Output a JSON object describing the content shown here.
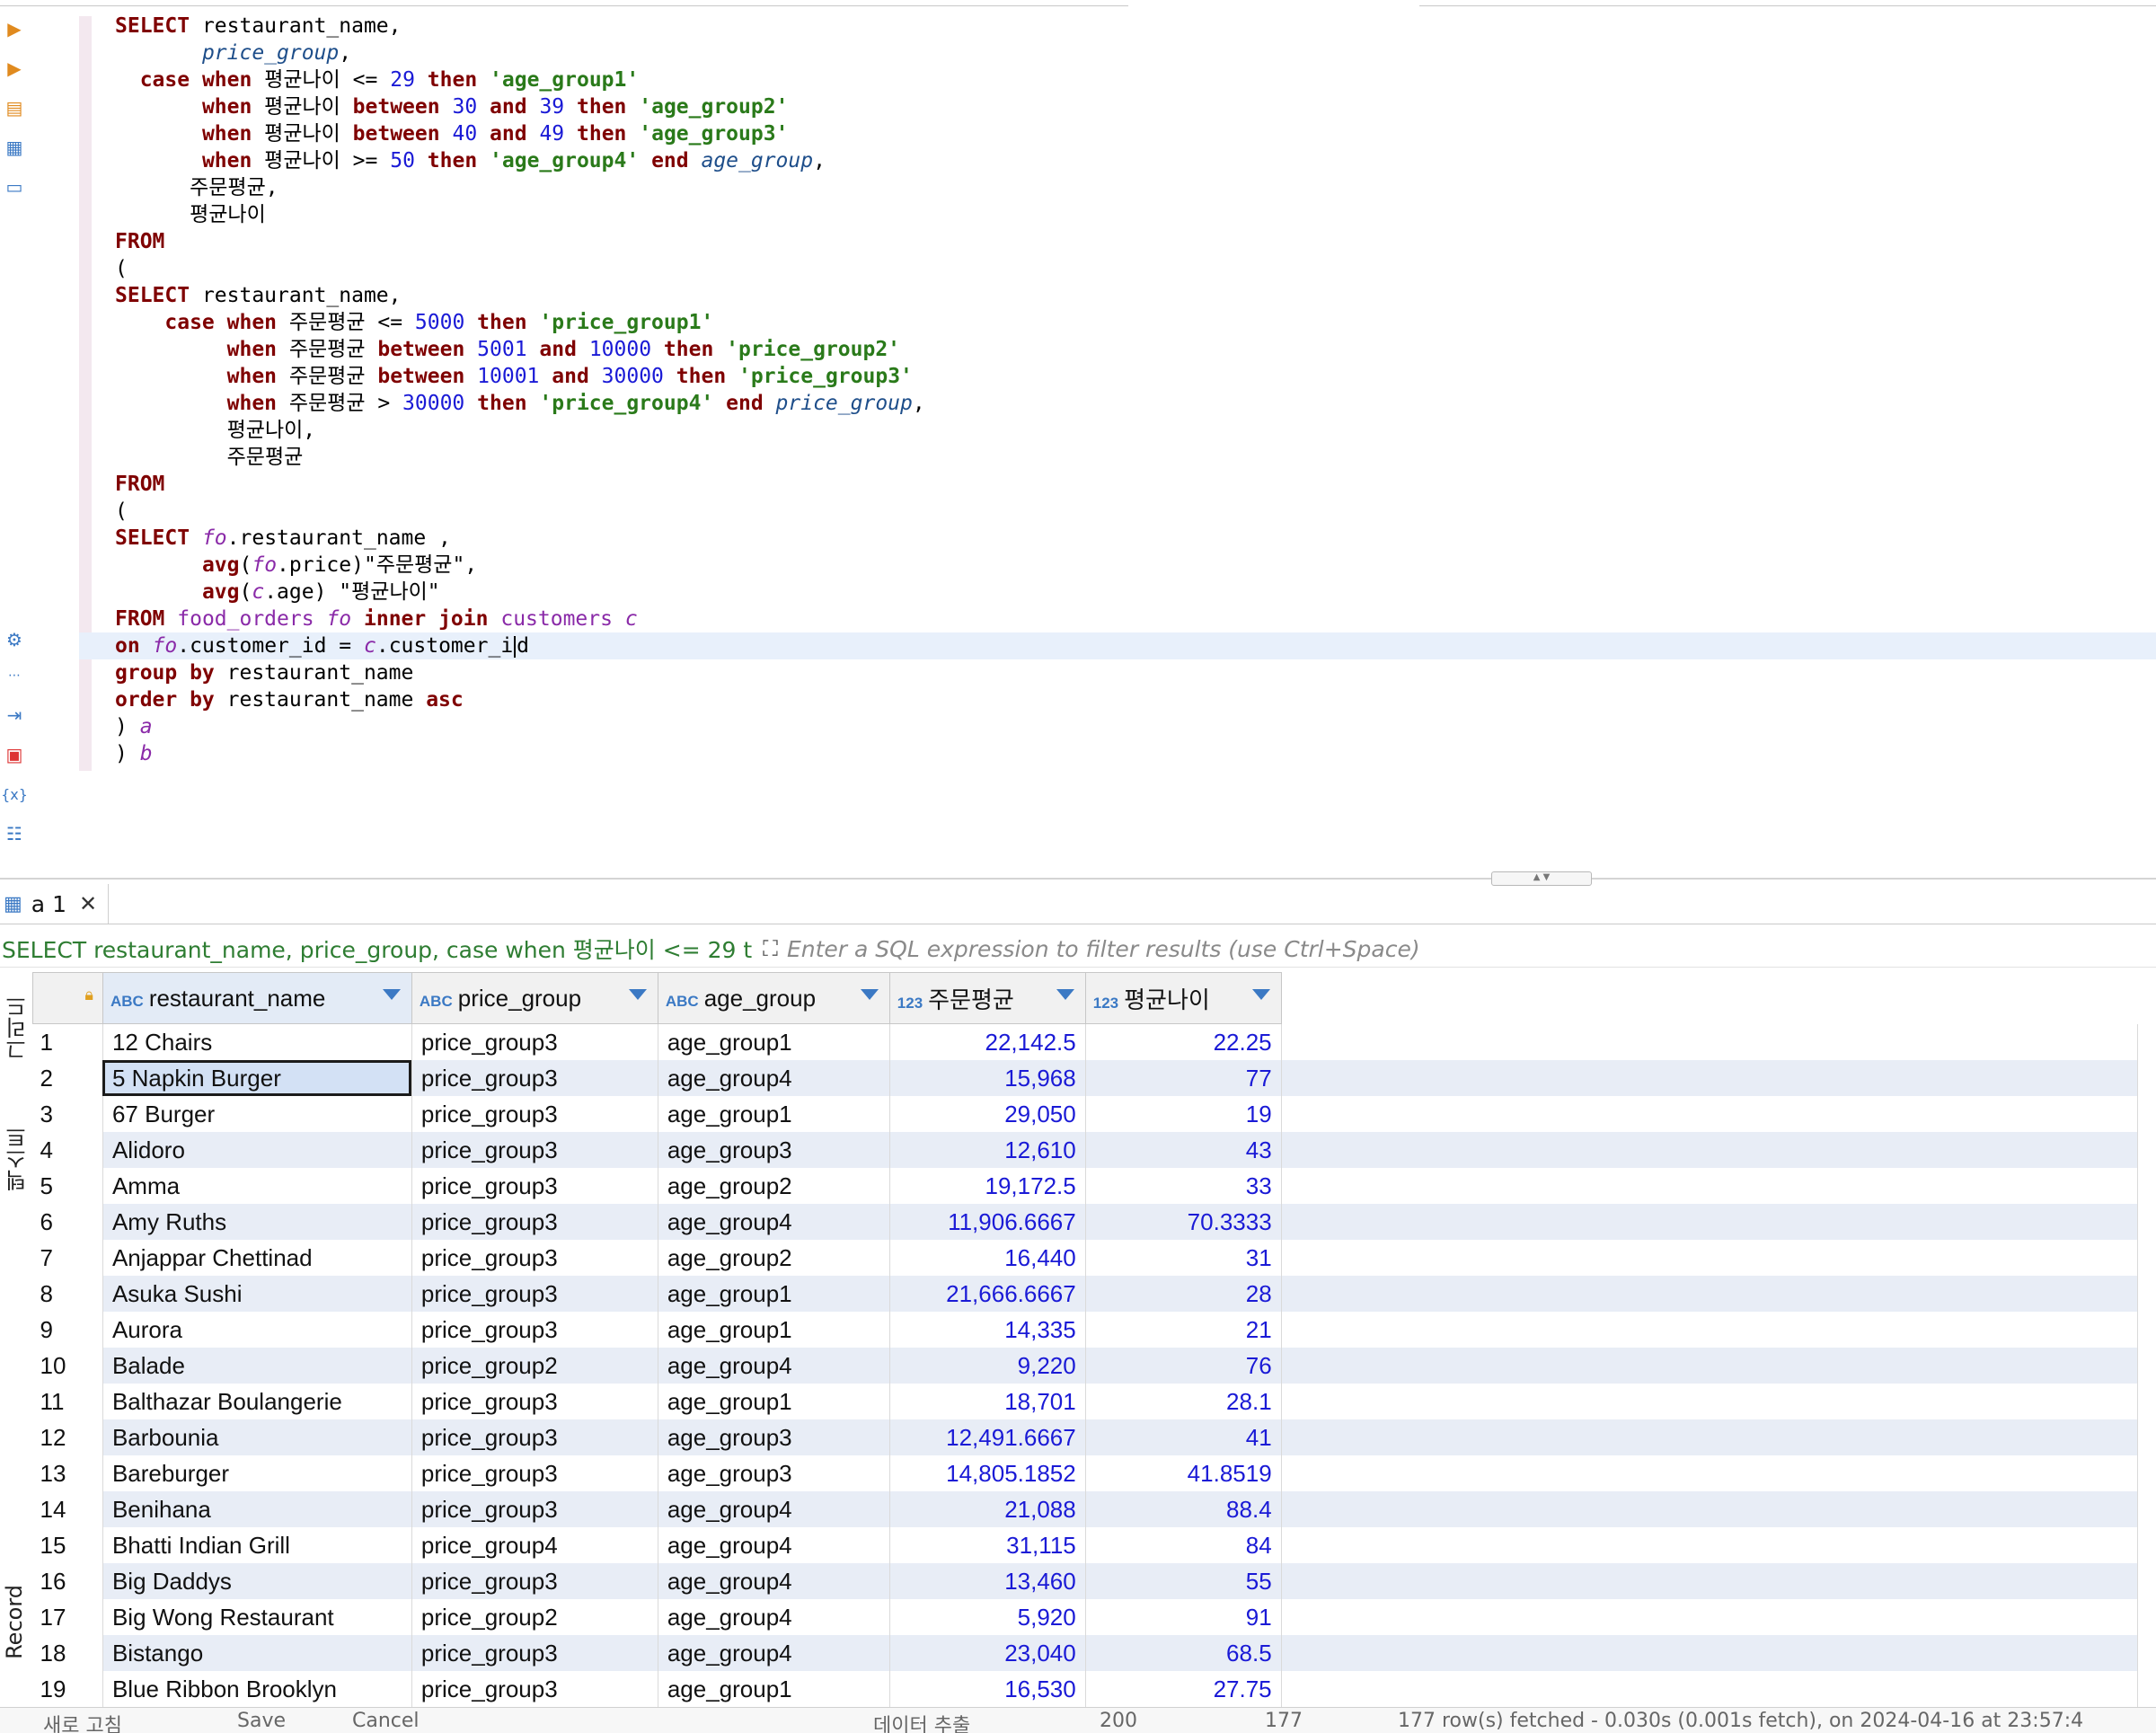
{
  "editor": {
    "lines": [
      [
        [
          "kw",
          "SELECT"
        ],
        [
          "t",
          " restaurant_name,"
        ]
      ],
      [
        [
          "t",
          "       "
        ],
        [
          "itc",
          "price_group"
        ],
        [
          "t",
          ","
        ]
      ],
      [
        [
          "t",
          "  "
        ],
        [
          "kw",
          "case"
        ],
        [
          "t",
          " "
        ],
        [
          "kw",
          "when"
        ],
        [
          "t",
          " 평균나이 <= "
        ],
        [
          "num",
          "29"
        ],
        [
          "t",
          " "
        ],
        [
          "kw",
          "then"
        ],
        [
          "t",
          " "
        ],
        [
          "str",
          "'age_group1'"
        ]
      ],
      [
        [
          "t",
          "       "
        ],
        [
          "kw",
          "when"
        ],
        [
          "t",
          " 평균나이 "
        ],
        [
          "kw",
          "between"
        ],
        [
          "t",
          " "
        ],
        [
          "num",
          "30"
        ],
        [
          "t",
          " "
        ],
        [
          "kw",
          "and"
        ],
        [
          "t",
          " "
        ],
        [
          "num",
          "39"
        ],
        [
          "t",
          " "
        ],
        [
          "kw",
          "then"
        ],
        [
          "t",
          " "
        ],
        [
          "str",
          "'age_group2'"
        ]
      ],
      [
        [
          "t",
          "       "
        ],
        [
          "kw",
          "when"
        ],
        [
          "t",
          " 평균나이 "
        ],
        [
          "kw",
          "between"
        ],
        [
          "t",
          " "
        ],
        [
          "num",
          "40"
        ],
        [
          "t",
          " "
        ],
        [
          "kw",
          "and"
        ],
        [
          "t",
          " "
        ],
        [
          "num",
          "49"
        ],
        [
          "t",
          " "
        ],
        [
          "kw",
          "then"
        ],
        [
          "t",
          " "
        ],
        [
          "str",
          "'age_group3'"
        ]
      ],
      [
        [
          "t",
          "       "
        ],
        [
          "kw",
          "when"
        ],
        [
          "t",
          " 평균나이 >= "
        ],
        [
          "num",
          "50"
        ],
        [
          "t",
          " "
        ],
        [
          "kw",
          "then"
        ],
        [
          "t",
          " "
        ],
        [
          "str",
          "'age_group4'"
        ],
        [
          "t",
          " "
        ],
        [
          "kw",
          "end"
        ],
        [
          "t",
          " "
        ],
        [
          "itc",
          "age_group"
        ],
        [
          "t",
          ","
        ]
      ],
      [
        [
          "t",
          "      주문평균,"
        ]
      ],
      [
        [
          "t",
          "      평균나이"
        ]
      ],
      [
        [
          "kw",
          "FROM"
        ]
      ],
      [
        [
          "t",
          "("
        ]
      ],
      [
        [
          "kw",
          "SELECT"
        ],
        [
          "t",
          " restaurant_name,"
        ]
      ],
      [
        [
          "t",
          "    "
        ],
        [
          "kw",
          "case"
        ],
        [
          "t",
          " "
        ],
        [
          "kw",
          "when"
        ],
        [
          "t",
          " 주문평균 <= "
        ],
        [
          "num",
          "5000"
        ],
        [
          "t",
          " "
        ],
        [
          "kw",
          "then"
        ],
        [
          "t",
          " "
        ],
        [
          "str",
          "'price_group1'"
        ]
      ],
      [
        [
          "t",
          "         "
        ],
        [
          "kw",
          "when"
        ],
        [
          "t",
          " 주문평균 "
        ],
        [
          "kw",
          "between"
        ],
        [
          "t",
          " "
        ],
        [
          "num",
          "5001"
        ],
        [
          "t",
          " "
        ],
        [
          "kw",
          "and"
        ],
        [
          "t",
          " "
        ],
        [
          "num",
          "10000"
        ],
        [
          "t",
          " "
        ],
        [
          "kw",
          "then"
        ],
        [
          "t",
          " "
        ],
        [
          "str",
          "'price_group2'"
        ]
      ],
      [
        [
          "t",
          "         "
        ],
        [
          "kw",
          "when"
        ],
        [
          "t",
          " 주문평균 "
        ],
        [
          "kw",
          "between"
        ],
        [
          "t",
          " "
        ],
        [
          "num",
          "10001"
        ],
        [
          "t",
          " "
        ],
        [
          "kw",
          "and"
        ],
        [
          "t",
          " "
        ],
        [
          "num",
          "30000"
        ],
        [
          "t",
          " "
        ],
        [
          "kw",
          "then"
        ],
        [
          "t",
          " "
        ],
        [
          "str",
          "'price_group3'"
        ]
      ],
      [
        [
          "t",
          "         "
        ],
        [
          "kw",
          "when"
        ],
        [
          "t",
          " 주문평균 > "
        ],
        [
          "num",
          "30000"
        ],
        [
          "t",
          " "
        ],
        [
          "kw",
          "then"
        ],
        [
          "t",
          " "
        ],
        [
          "str",
          "'price_group4'"
        ],
        [
          "t",
          " "
        ],
        [
          "kw",
          "end"
        ],
        [
          "t",
          " "
        ],
        [
          "itc",
          "price_group"
        ],
        [
          "t",
          ","
        ]
      ],
      [
        [
          "t",
          "         평균나이,"
        ]
      ],
      [
        [
          "t",
          "         주문평균"
        ]
      ],
      [
        [
          "kw",
          "FROM"
        ]
      ],
      [
        [
          "t",
          "("
        ]
      ],
      [
        [
          "kw",
          "SELECT"
        ],
        [
          "t",
          " "
        ],
        [
          "ali",
          "fo"
        ],
        [
          "t",
          ".restaurant_name ,"
        ]
      ],
      [
        [
          "t",
          "       "
        ],
        [
          "kw",
          "avg"
        ],
        [
          "t",
          "("
        ],
        [
          "ali",
          "fo"
        ],
        [
          "t",
          ".price)\"주문평균\","
        ]
      ],
      [
        [
          "t",
          "       "
        ],
        [
          "kw",
          "avg"
        ],
        [
          "t",
          "("
        ],
        [
          "ali",
          "c"
        ],
        [
          "t",
          ".age) \"평균나이\""
        ]
      ],
      [
        [
          "kw",
          "FROM"
        ],
        [
          "t",
          " "
        ],
        [
          "tbl",
          "food_orders"
        ],
        [
          "t",
          " "
        ],
        [
          "ali",
          "fo"
        ],
        [
          "t",
          " "
        ],
        [
          "kw",
          "inner join"
        ],
        [
          "t",
          " "
        ],
        [
          "tbl",
          "customers"
        ],
        [
          "t",
          " "
        ],
        [
          "ali",
          "c"
        ]
      ],
      [
        [
          "kw",
          "on"
        ],
        [
          "t",
          " "
        ],
        [
          "ali",
          "fo"
        ],
        [
          "t",
          ".customer_id = "
        ],
        [
          "ali",
          "c"
        ],
        [
          "t",
          ".customer_i"
        ],
        [
          "caret",
          ""
        ],
        [
          "t",
          "d"
        ]
      ],
      [
        [
          "kw",
          "group by"
        ],
        [
          "t",
          " restaurant_name"
        ]
      ],
      [
        [
          "kw",
          "order by"
        ],
        [
          "t",
          " restaurant_name "
        ],
        [
          "kw",
          "asc"
        ]
      ],
      [
        [
          "t",
          ") "
        ],
        [
          "ali",
          "a"
        ]
      ],
      [
        [
          "t",
          ") "
        ],
        [
          "ali",
          "b"
        ]
      ]
    ],
    "current_line": 23
  },
  "result_tab": {
    "label": "a 1"
  },
  "filter": {
    "query_label": "SELECT restaurant_name, price_group, case when 평균나이 <= 29 t",
    "placeholder": "Enter a SQL expression to filter results (use Ctrl+Space)"
  },
  "side_tabs": {
    "grid": "그리드",
    "text": "텍스트",
    "record": "Record"
  },
  "columns": [
    {
      "type": "ABC",
      "name": "restaurant_name"
    },
    {
      "type": "ABC",
      "name": "price_group"
    },
    {
      "type": "ABC",
      "name": "age_group"
    },
    {
      "type": "123",
      "name": "주문평균"
    },
    {
      "type": "123",
      "name": "평균나이"
    }
  ],
  "rows": [
    [
      "1",
      "12 Chairs",
      "price_group3",
      "age_group1",
      "22,142.5",
      "22.25"
    ],
    [
      "2",
      "5 Napkin Burger",
      "price_group3",
      "age_group4",
      "15,968",
      "77"
    ],
    [
      "3",
      "67 Burger",
      "price_group3",
      "age_group1",
      "29,050",
      "19"
    ],
    [
      "4",
      "Alidoro",
      "price_group3",
      "age_group3",
      "12,610",
      "43"
    ],
    [
      "5",
      "Amma",
      "price_group3",
      "age_group2",
      "19,172.5",
      "33"
    ],
    [
      "6",
      "Amy Ruths",
      "price_group3",
      "age_group4",
      "11,906.6667",
      "70.3333"
    ],
    [
      "7",
      "Anjappar Chettinad",
      "price_group3",
      "age_group2",
      "16,440",
      "31"
    ],
    [
      "8",
      "Asuka Sushi",
      "price_group3",
      "age_group1",
      "21,666.6667",
      "28"
    ],
    [
      "9",
      "Aurora",
      "price_group3",
      "age_group1",
      "14,335",
      "21"
    ],
    [
      "10",
      "Balade",
      "price_group2",
      "age_group4",
      "9,220",
      "76"
    ],
    [
      "11",
      "Balthazar Boulangerie",
      "price_group3",
      "age_group1",
      "18,701",
      "28.1"
    ],
    [
      "12",
      "Barbounia",
      "price_group3",
      "age_group3",
      "12,491.6667",
      "41"
    ],
    [
      "13",
      "Bareburger",
      "price_group3",
      "age_group3",
      "14,805.1852",
      "41.8519"
    ],
    [
      "14",
      "Benihana",
      "price_group3",
      "age_group4",
      "21,088",
      "88.4"
    ],
    [
      "15",
      "Bhatti Indian Grill",
      "price_group4",
      "age_group4",
      "31,115",
      "84"
    ],
    [
      "16",
      "Big Daddys",
      "price_group3",
      "age_group4",
      "13,460",
      "55"
    ],
    [
      "17",
      "Big Wong Restaurant",
      "price_group2",
      "age_group4",
      "5,920",
      "91"
    ],
    [
      "18",
      "Bistango",
      "price_group3",
      "age_group4",
      "23,040",
      "68.5"
    ],
    [
      "19",
      "Blue Ribbon Brooklyn",
      "price_group3",
      "age_group1",
      "16,530",
      "27.75"
    ]
  ],
  "selected_row": 2,
  "status": {
    "refresh": "새로 고침",
    "save": "Save",
    "cancel": "Cancel",
    "export": "데이터 추출",
    "fetch_size": "200",
    "row_count": "177",
    "message": "177 row(s) fetched - 0.030s (0.001s fetch), on 2024-04-16 at 23:57:4"
  }
}
